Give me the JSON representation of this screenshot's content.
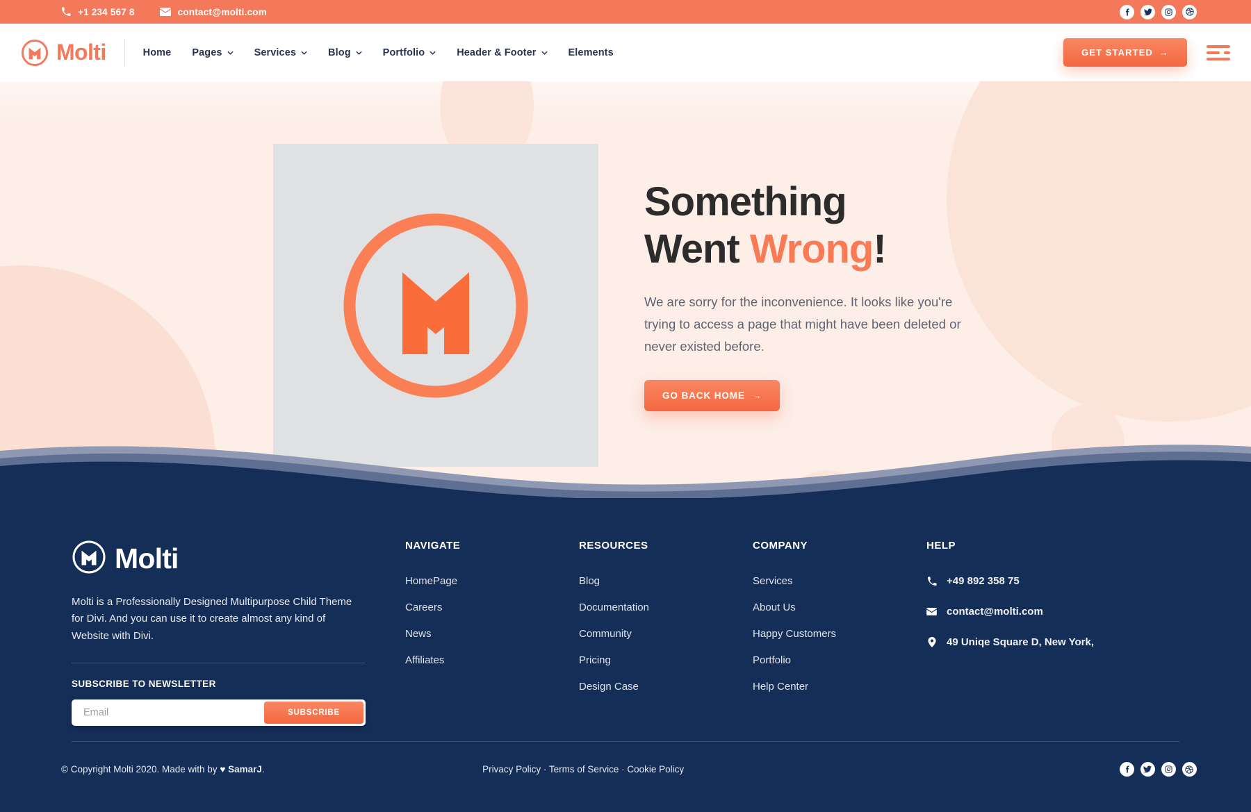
{
  "topbar": {
    "phone": "+1 234 567 8",
    "email": "contact@molti.com",
    "phone_icon": "phone-icon",
    "email_icon": "envelope-icon",
    "socials": [
      {
        "name": "facebook-icon",
        "label": "Facebook"
      },
      {
        "name": "twitter-icon",
        "label": "Twitter"
      },
      {
        "name": "instagram-icon",
        "label": "Instagram"
      },
      {
        "name": "dribbble-icon",
        "label": "Dribbble"
      }
    ]
  },
  "header": {
    "brand": "Molti",
    "logo_icon": "molti-m-logo-icon",
    "nav": [
      {
        "label": "Home",
        "has_caret": false
      },
      {
        "label": "Pages",
        "has_caret": true
      },
      {
        "label": "Services",
        "has_caret": true
      },
      {
        "label": "Blog",
        "has_caret": true
      },
      {
        "label": "Portfolio",
        "has_caret": true
      },
      {
        "label": "Header & Footer",
        "has_caret": true
      },
      {
        "label": "Elements",
        "has_caret": false
      }
    ],
    "cta_label": "GET STARTED",
    "cta_arrow": "→",
    "menu_icon": "hamburger-menu-icon"
  },
  "hero": {
    "image_alt": "molti-m-logo-illustration",
    "title_line1": "Something",
    "title_line2_plain": "Went ",
    "title_line2_accent": "Wrong",
    "title_line2_tail": "!",
    "subtitle": "We are sorry for the inconvenience. It looks like you're trying to access a page that might have been deleted or never existed before.",
    "button_label": "GO BACK HOME",
    "button_arrow": "→"
  },
  "footer": {
    "brand": "Molti",
    "logo_icon": "molti-m-logo-icon",
    "description": "Molti is a Professionally Designed  Multipurpose Child Theme for Divi. And you can use it to create almost any kind of Website with Divi.",
    "newsletter_title": "SUBSCRIBE TO NEWSLETTER",
    "newsletter_placeholder": "Email",
    "newsletter_value": "",
    "newsletter_button": "SUBSCRIBE",
    "columns": [
      {
        "heading": "NAVIGATE",
        "links": [
          "HomePage",
          "Careers",
          "News",
          "Affiliates"
        ]
      },
      {
        "heading": "RESOURCES",
        "links": [
          "Blog",
          "Documentation",
          "Community",
          "Pricing",
          "Design Case"
        ]
      },
      {
        "heading": "COMPANY",
        "links": [
          "Services",
          "About Us",
          "Happy Customers",
          "Portfolio",
          "Help Center"
        ]
      }
    ],
    "help": {
      "heading": "HELP",
      "items": [
        {
          "icon": "phone-icon",
          "text": "+49 892 358 75"
        },
        {
          "icon": "envelope-icon",
          "text": "contact@molti.com"
        },
        {
          "icon": "location-pin-icon",
          "text": "49 Uniqe Square D, New York,"
        }
      ]
    },
    "copyright_pre": "© Copyright Molti 2020. Made with by ",
    "copyright_heart": "♥",
    "copyright_author": "SamarJ",
    "copyright_post": ".",
    "legal": "Privacy Policy · Terms of Service · Cookie Policy",
    "socials": [
      {
        "name": "facebook-icon",
        "label": "Facebook"
      },
      {
        "name": "twitter-icon",
        "label": "Twitter"
      },
      {
        "name": "instagram-icon",
        "label": "Instagram"
      },
      {
        "name": "dribbble-icon",
        "label": "Dribbble"
      }
    ]
  },
  "colors": {
    "accent": "#f4795b",
    "accent_dark": "#f4683f",
    "navy": "#152e58",
    "hero_bg": "#fdeee8",
    "hero_image_bg": "#e0e1e3",
    "heading": "#2c2c2c",
    "nav_text": "#2a3350"
  }
}
